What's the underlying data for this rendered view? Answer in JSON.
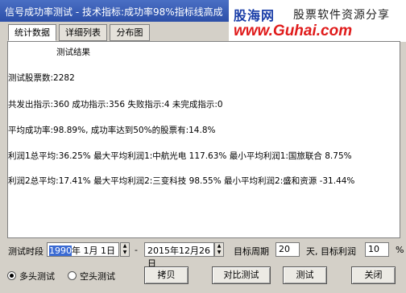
{
  "window": {
    "title": "信号成功率测试 - 技术指标:成功率98%指标线高成"
  },
  "banner": {
    "brand": "股海网",
    "slogan": "股票软件资源分享",
    "url": "www.Guhai.com"
  },
  "tabs": [
    "统计数据",
    "详细列表",
    "分布图"
  ],
  "results": {
    "heading": "测试结果",
    "lines": [
      "测试股票数:2282",
      "共发出指示:360 成功指示:356 失败指示:4 未完成指示:0",
      "平均成功率:98.89%, 成功率达到50%的股票有:14.8%",
      "利润1总平均:36.25% 最大平均利润1:中航光电 117.63% 最小平均利润1:国旅联合 8.75%",
      "利润2总平均:17.41% 最大平均利润2:三变科技 98.55% 最小平均利润2:盛和资源 -31.44%"
    ]
  },
  "controls": {
    "period_label": "测试时段",
    "start_year": "1990",
    "start_rest": "年  1月  1日",
    "dash": "-",
    "end_date": "2015年12月26日",
    "target_period_label": "目标周期",
    "target_period_value": "20",
    "target_profit_label": "天, 目标利润",
    "target_profit_value": "10",
    "percent": "%",
    "radio_long": "多头测试",
    "radio_short": "空头测试",
    "btn_copy": "拷贝",
    "btn_compare": "对比测试",
    "btn_test": "测试",
    "btn_close": "关闭"
  }
}
